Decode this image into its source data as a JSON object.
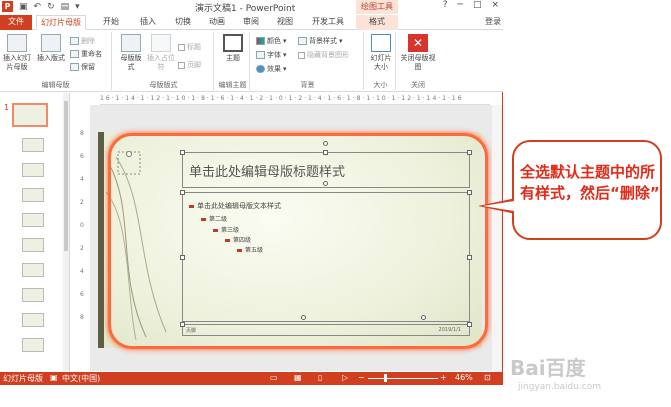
{
  "window": {
    "title": "演示文稿1 - PowerPoint",
    "context_tab": "绘图工具",
    "app_icon": "P",
    "controls": [
      "?",
      "─",
      "□",
      "×"
    ]
  },
  "tabs": {
    "file": "文件",
    "slide_master": "幻灯片母版",
    "home": "开始",
    "insert": "插入",
    "transitions": "切换",
    "animations": "动画",
    "review": "审阅",
    "view": "视图",
    "developer": "开发工具",
    "format": "格式",
    "login": "登录"
  },
  "ribbon": {
    "edit_master": {
      "insert_slide_master": "插入幻灯片母版",
      "insert_layout": "插入版式",
      "delete": "删除",
      "rename": "重命名",
      "preserve": "保留",
      "label": "编辑母版"
    },
    "master_layout": {
      "master_layout": "母版版式",
      "insert_placeholder": "插入占位符",
      "title": "标题",
      "footer": "页脚",
      "label": "母版版式"
    },
    "edit_theme": {
      "themes": "主题",
      "label": "编辑主题"
    },
    "background": {
      "colors": "颜色",
      "fonts": "字体",
      "effects": "效果",
      "background_styles": "背景样式",
      "hide_background": "隐藏背景图形",
      "label": "背景"
    },
    "size": {
      "slide_size": "幻灯片大小",
      "label": "大小"
    },
    "close": {
      "close_master_view": "关闭母版视图",
      "label": "关闭"
    }
  },
  "ruler": {
    "horizontal": "16·1·14·1·12·1·10·1·8·1·6·1·4·1·2·1·0·1·2·1·4·1·6·1·8·1·10·1·12·1·14·1·16",
    "vertical": [
      "8",
      "6",
      "4",
      "2",
      "0",
      "2",
      "4",
      "6",
      "8"
    ]
  },
  "thumbnails": {
    "first_number": "1"
  },
  "slide": {
    "title_placeholder": "单击此处编辑母版标题样式",
    "body_levels": [
      "单击此处编辑母版文本样式",
      "第二级",
      "第三级",
      "第四级",
      "第五级"
    ],
    "footer_num": "页脚",
    "footer_date": "2019/1/1"
  },
  "status": {
    "view_name": "幻灯片母版",
    "language": "中文(中国)",
    "zoom": "46%",
    "zoom_fraction": 0.46
  },
  "callout": {
    "text": "全选默认主题中的所有样式，然后“删除”"
  },
  "watermark": {
    "brand": "Bai百度",
    "sub": "jingyan.baidu.com"
  },
  "colors": {
    "accent": "#d04020",
    "highlight": "#ff6a3a",
    "callout_text": "#e02b18"
  }
}
